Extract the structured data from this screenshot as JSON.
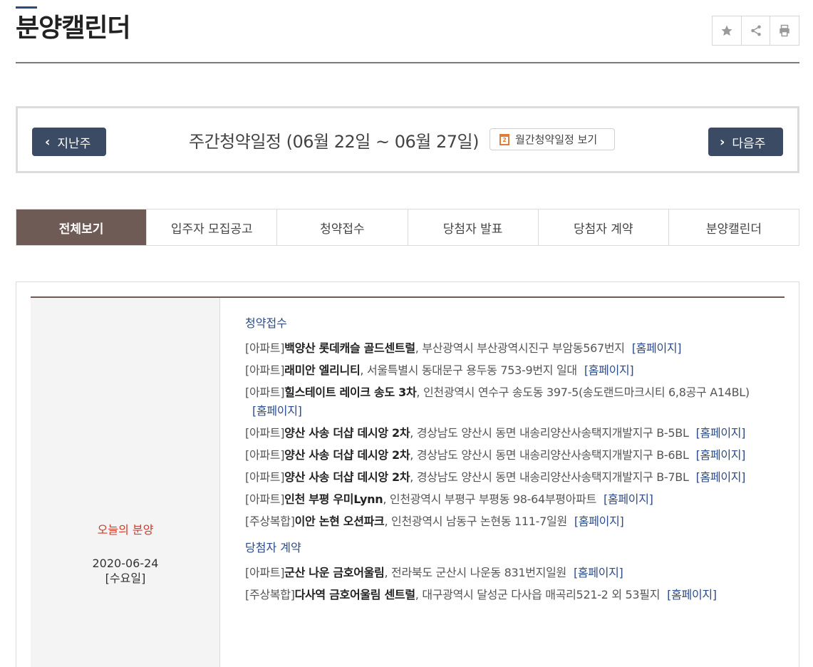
{
  "page": {
    "title": "분양캘린더"
  },
  "toolbar": {
    "icons": [
      "star-icon",
      "share-icon",
      "print-icon"
    ]
  },
  "week": {
    "prev_label": "지난주",
    "next_label": "다음주",
    "prev_chevron": "‹",
    "next_chevron": "›",
    "title": "주간청약일정 (06월 22일 ~ 06월 27일)",
    "month_button": "월간청약일정 보기",
    "calendar_icon_text": "2"
  },
  "tabs": [
    {
      "label": "전체보기",
      "active": true
    },
    {
      "label": "입주자 모집공고",
      "active": false
    },
    {
      "label": "청약접수",
      "active": false
    },
    {
      "label": "당첨자 발표",
      "active": false
    },
    {
      "label": "당첨자 계약",
      "active": false
    },
    {
      "label": "분양캘린더",
      "active": false
    }
  ],
  "day": {
    "label": "오늘의 분양",
    "date": "2020-06-24",
    "weekday": "[수요일]"
  },
  "sections": [
    {
      "heading": "청약접수",
      "entries": [
        {
          "kind": "[아파트]",
          "name": "백양산 롯데캐슬 골드센트럴",
          "addr": ", 부산광역시 부산광역시진구 부암동567번지",
          "link": "[홈페이지]"
        },
        {
          "kind": "[아파트]",
          "name": "래미안 엘리니티",
          "addr": ", 서울특별시 동대문구 용두동 753-9번지 일대",
          "link": "[홈페이지]"
        },
        {
          "kind": "[아파트]",
          "name": "힐스테이트 레이크 송도 3차",
          "addr": ", 인천광역시 연수구 송도동 397-5(송도랜드마크시티 6,8공구 A14BL)",
          "link": "[홈페이지]"
        },
        {
          "kind": "[아파트]",
          "name": "양산 사송 더샵 데시앙 2차",
          "addr": ", 경상남도 양산시 동면 내송리양산사송택지개발지구 B-5BL",
          "link": "[홈페이지]"
        },
        {
          "kind": "[아파트]",
          "name": "양산 사송 더샵 데시앙 2차",
          "addr": ", 경상남도 양산시 동면 내송리양산사송택지개발지구 B-6BL",
          "link": "[홈페이지]"
        },
        {
          "kind": "[아파트]",
          "name": "양산 사송 더샵 데시앙 2차",
          "addr": ", 경상남도 양산시 동면 내송리양산사송택지개발지구 B-7BL",
          "link": "[홈페이지]"
        },
        {
          "kind": "[아파트]",
          "name": "인천 부평 우미Lynn",
          "addr": ", 인천광역시 부평구 부평동 98-64부평아파트",
          "link": "[홈페이지]"
        },
        {
          "kind": "[주상복합]",
          "name": "이안 논현 오션파크",
          "addr": ", 인천광역시 남동구 논현동 111-7일원",
          "link": "[홈페이지]"
        }
      ]
    },
    {
      "heading": "당첨자 계약",
      "entries": [
        {
          "kind": "[아파트]",
          "name": "군산 나운 금호어울림",
          "addr": ", 전라북도 군산시 나운동 831번지일원",
          "link": "[홈페이지]"
        },
        {
          "kind": "[주상복합]",
          "name": "다사역 금호어울림 센트럴",
          "addr": ", 대구광역시 달성군 다사읍 매곡리521-2 외 53필지",
          "link": "[홈페이지]"
        }
      ]
    }
  ]
}
